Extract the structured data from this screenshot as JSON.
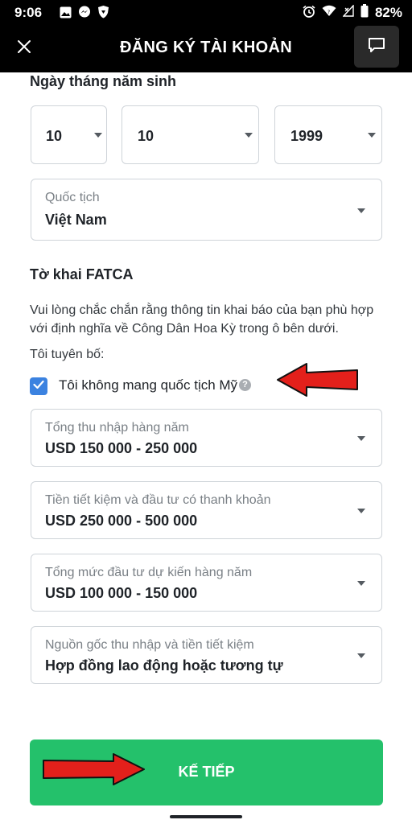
{
  "status_bar": {
    "time": "9:06",
    "battery": "82%",
    "left_icons": [
      "image-icon",
      "messenger-icon",
      "shield-icon"
    ],
    "right_icons": [
      "alarm-icon",
      "wifi-icon",
      "signal-icon",
      "battery-icon"
    ]
  },
  "header": {
    "title": "ĐĂNG KÝ TÀI KHOẢN"
  },
  "dob": {
    "label": "Ngày tháng năm sinh",
    "day": "10",
    "month": "10",
    "year": "1999"
  },
  "nationality": {
    "label": "Quốc tịch",
    "value": "Việt Nam"
  },
  "fatca": {
    "title": "Tờ khai FATCA",
    "description": "Vui lòng chắc chắn rằng thông tin khai báo của bạn phù hợp với định nghĩa về Công Dân Hoa Kỳ trong ô bên dưới.",
    "declare_label": "Tôi tuyên bố:",
    "checkbox_label": "Tôi không mang quốc tịch Mỹ",
    "checkbox_checked": true,
    "help_glyph": "?"
  },
  "income": {
    "label": "Tổng thu nhập hàng năm",
    "value": "USD 150 000 - 250 000"
  },
  "savings": {
    "label": "Tiền tiết kiệm và đầu tư có thanh khoản",
    "value": "USD 250 000 - 500 000"
  },
  "investment": {
    "label": "Tổng mức đầu tư dự kiến hàng năm",
    "value": "USD 100 000 - 150 000"
  },
  "source": {
    "label": "Nguồn gốc thu nhập và tiền tiết kiệm",
    "value": "Hợp đồng lao động hoặc tương tự"
  },
  "next_button": {
    "label": "KẾ TIẾP"
  },
  "colors": {
    "header_bg": "#000000",
    "accent_green": "#24c16b",
    "checkbox_blue": "#3b82e0",
    "annotation_red": "#e3201b"
  }
}
